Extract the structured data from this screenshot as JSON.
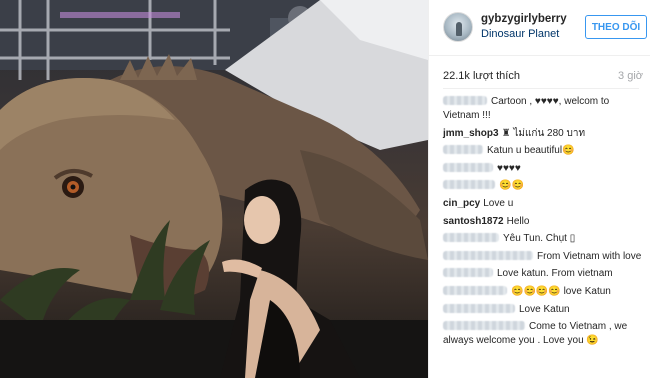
{
  "post": {
    "photo_alt": "Photo",
    "username": "gybzygirlyberry",
    "location": "Dinosaur Planet",
    "follow_label": "THEO DÕI",
    "likes": "22.1k lượt thích",
    "time": "3 giờ"
  },
  "comments": [
    {
      "user": "",
      "blurred": true,
      "text": "Cartoon , ♥♥♥♥, welcom to Vietnam !!!"
    },
    {
      "user": "jmm_shop3",
      "blurred": false,
      "text": "♜ ไม่แก่น 280 บาท"
    },
    {
      "user": "",
      "blurred": true,
      "text": "Katun u beautiful😊"
    },
    {
      "user": "",
      "blurred": true,
      "text": "♥♥♥♥"
    },
    {
      "user": "",
      "blurred": true,
      "text": "😊😊"
    },
    {
      "user": "cin_pcy",
      "blurred": false,
      "text": "Love u"
    },
    {
      "user": "santosh1872",
      "blurred": false,
      "text": "Hello"
    },
    {
      "user": "",
      "blurred": true,
      "text": "Yêu Tun. Chụt ▯"
    },
    {
      "user": "",
      "blurred": true,
      "text": "From Vietnam with love"
    },
    {
      "user": "",
      "blurred": true,
      "text": "Love katun. From vietnam"
    },
    {
      "user": "",
      "blurred": true,
      "text": "😊😊😊😊 love Katun"
    },
    {
      "user": "",
      "blurred": true,
      "text": "Love Katun"
    },
    {
      "user": "",
      "blurred": true,
      "text": "Come to Vietnam , we always welcome you . Love you 😉"
    }
  ]
}
